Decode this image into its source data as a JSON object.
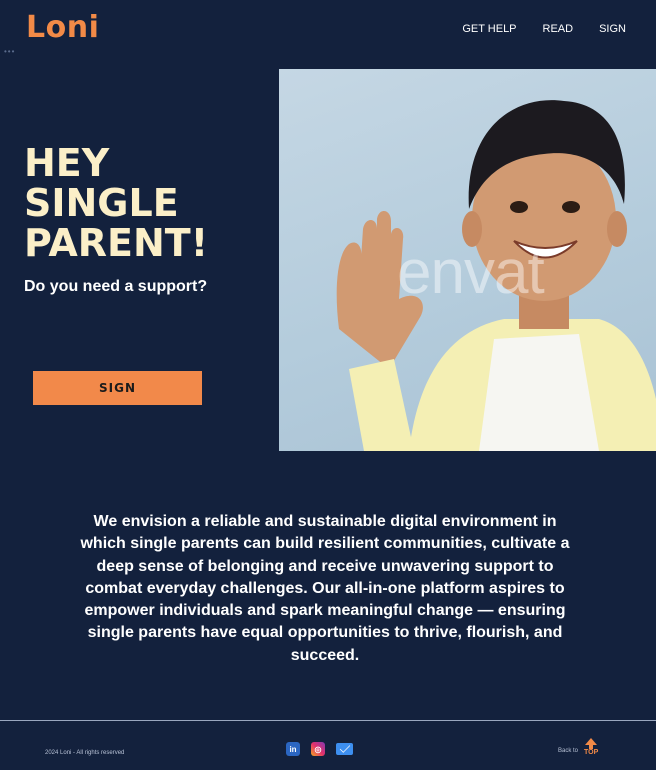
{
  "header": {
    "logo": "Loni",
    "nav": [
      {
        "label": "GET HELP"
      },
      {
        "label": "READ"
      },
      {
        "label": "SIGN"
      }
    ]
  },
  "hero": {
    "title": "Hey Single Parent!",
    "subtitle": "Do you need a support?",
    "cta_label": "Sign",
    "watermark": "envat"
  },
  "mission": {
    "text": "We envision a reliable and sustainable digital environment in which single parents can build resilient communities, cultivate a deep sense of belonging and receive unwavering support to combat everyday challenges. Our all-in-one platform aspires to empower individuals and spark meaningful change — ensuring single parents have equal opportunities to thrive, flourish, and succeed."
  },
  "footer": {
    "copyright": "2024 Loni - All rights reserved",
    "socials": [
      {
        "icon": "linkedin-icon",
        "glyph": "in"
      },
      {
        "icon": "instagram-icon",
        "glyph": "◎"
      },
      {
        "icon": "mail-icon",
        "glyph": ""
      }
    ],
    "back_label": "Back to",
    "top_label": "TOP"
  },
  "colors": {
    "background": "#13213d",
    "accent": "#f28a47",
    "title": "#fbefc8"
  }
}
